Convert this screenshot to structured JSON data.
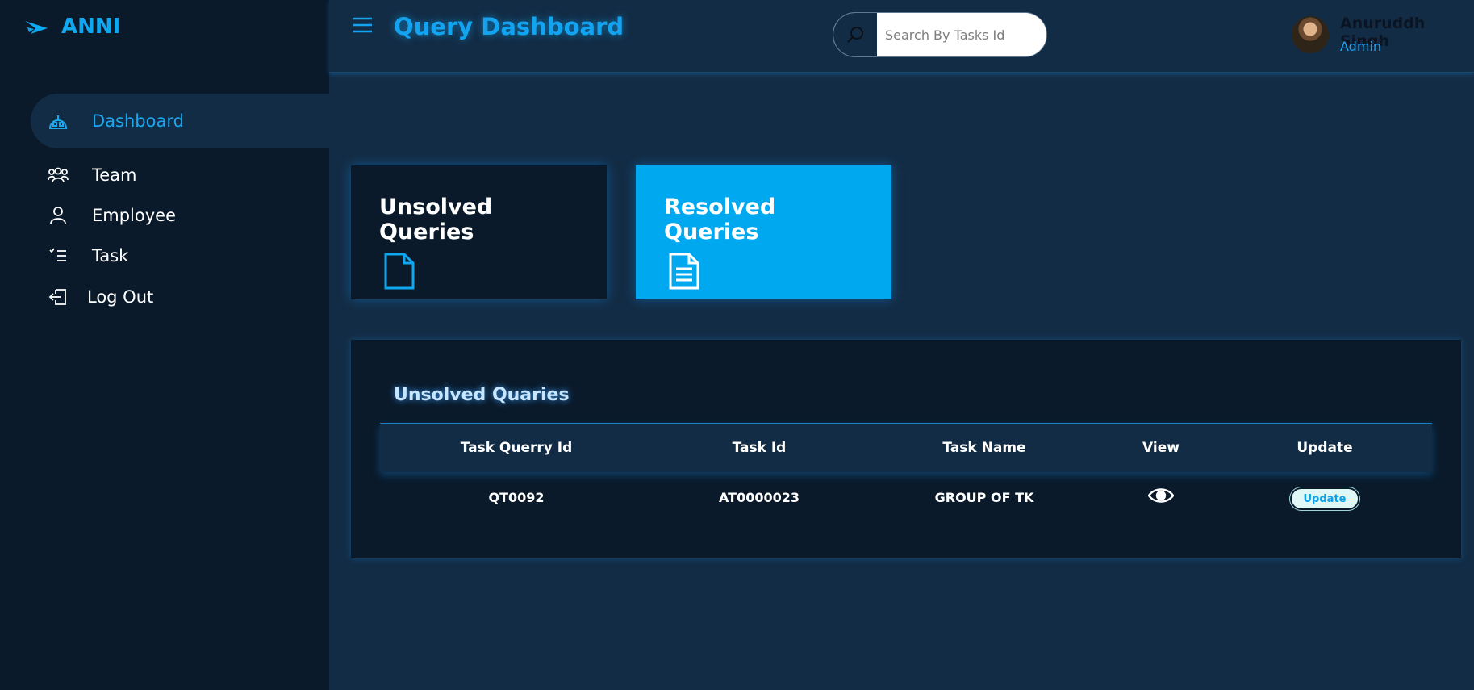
{
  "brand": {
    "name": "ANNI",
    "icon": "paper-plane-icon"
  },
  "sidebar": {
    "items": [
      {
        "label": "Dashboard",
        "icon": "dashboard-icon",
        "active": true
      },
      {
        "label": "Team",
        "icon": "team-icon"
      },
      {
        "label": "Employee",
        "icon": "user-icon"
      },
      {
        "label": "Task",
        "icon": "task-list-icon"
      },
      {
        "label": "Log Out",
        "icon": "logout-icon"
      }
    ]
  },
  "header": {
    "title": "Query Dashboard",
    "search": {
      "placeholder": "Search By Tasks Id",
      "value": ""
    },
    "user": {
      "name": "Anuruddh Singh",
      "role": "Admin"
    }
  },
  "cards": {
    "unsolved": {
      "title": "Unsolved Queries"
    },
    "resolved": {
      "title": "Resolved Queries"
    }
  },
  "table": {
    "title": "Unsolved Quaries",
    "columns": [
      "Task Querry Id",
      "Task Id",
      "Task Name",
      "View",
      "Update"
    ],
    "rows": [
      {
        "query_id": "QT0092",
        "task_id": "AT0000023",
        "task_name": "GROUP OF TK",
        "update_label": "Update"
      }
    ]
  },
  "colors": {
    "accent": "#0fa8f0",
    "sidebar_bg": "#0a1a2a",
    "main_bg": "#132c45",
    "resolved_card": "#00a8ef"
  }
}
